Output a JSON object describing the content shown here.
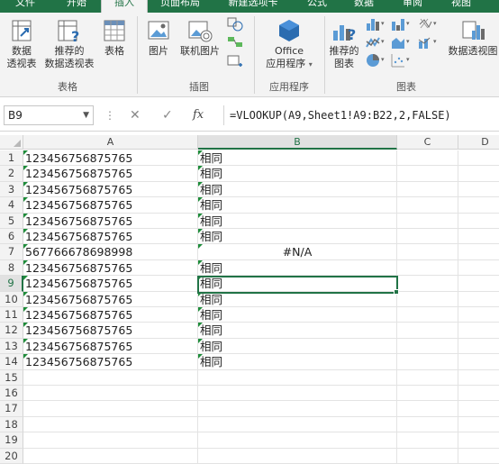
{
  "tabs": [
    {
      "label": "文件",
      "active": false
    },
    {
      "label": "开始",
      "active": false
    },
    {
      "label": "插入",
      "active": true
    },
    {
      "label": "页面布局",
      "active": false
    },
    {
      "label": "新建选项卡",
      "active": false
    },
    {
      "label": "公式",
      "active": false
    },
    {
      "label": "数据",
      "active": false
    },
    {
      "label": "审阅",
      "active": false
    },
    {
      "label": "视图",
      "active": false
    }
  ],
  "ribbon": {
    "tables_group": {
      "label": "表格",
      "pivot_table": [
        "数据",
        "透视表"
      ],
      "recommended_pivot": [
        "推荐的",
        "数据透视表"
      ],
      "table": "表格"
    },
    "illustrations_group": {
      "label": "插图",
      "pictures": "图片",
      "online_pictures": "联机图片"
    },
    "apps_group": {
      "label": "应用程序",
      "office_apps": [
        "Office",
        "应用程序"
      ]
    },
    "charts_group": {
      "label": "图表",
      "recommended_charts": [
        "推荐的",
        "图表"
      ],
      "pivot_chart": "数据透视图"
    }
  },
  "formula_bar": {
    "name_box": "B9",
    "fx": "fx",
    "formula": "=VLOOKUP(A9,Sheet1!A9:B22,2,FALSE)"
  },
  "sheet": {
    "columns": [
      "A",
      "B",
      "C",
      "D"
    ],
    "selected_column": "B",
    "selected_row": 9,
    "rows": [
      {
        "n": "1",
        "a": "123456756875765",
        "b": "相同"
      },
      {
        "n": "2",
        "a": "123456756875765",
        "b": "相同"
      },
      {
        "n": "3",
        "a": "123456756875765",
        "b": "相同"
      },
      {
        "n": "4",
        "a": "123456756875765",
        "b": "相同"
      },
      {
        "n": "5",
        "a": "123456756875765",
        "b": "相同"
      },
      {
        "n": "6",
        "a": "123456756875765",
        "b": "相同"
      },
      {
        "n": "7",
        "a": "567766678698998",
        "b": "#N/A"
      },
      {
        "n": "8",
        "a": "123456756875765",
        "b": "相同"
      },
      {
        "n": "9",
        "a": "123456756875765",
        "b": "相同"
      },
      {
        "n": "10",
        "a": "123456756875765",
        "b": "相同"
      },
      {
        "n": "11",
        "a": "123456756875765",
        "b": "相同"
      },
      {
        "n": "12",
        "a": "123456756875765",
        "b": "相同"
      },
      {
        "n": "13",
        "a": "123456756875765",
        "b": "相同"
      },
      {
        "n": "14",
        "a": "123456756875765",
        "b": "相同"
      },
      {
        "n": "15",
        "a": "",
        "b": ""
      },
      {
        "n": "16",
        "a": "",
        "b": ""
      },
      {
        "n": "17",
        "a": "",
        "b": ""
      },
      {
        "n": "18",
        "a": "",
        "b": ""
      },
      {
        "n": "19",
        "a": "",
        "b": ""
      },
      {
        "n": "20",
        "a": "",
        "b": ""
      }
    ]
  },
  "colors": {
    "accent": "#217346",
    "error_indicator": "#1e8c3a"
  }
}
